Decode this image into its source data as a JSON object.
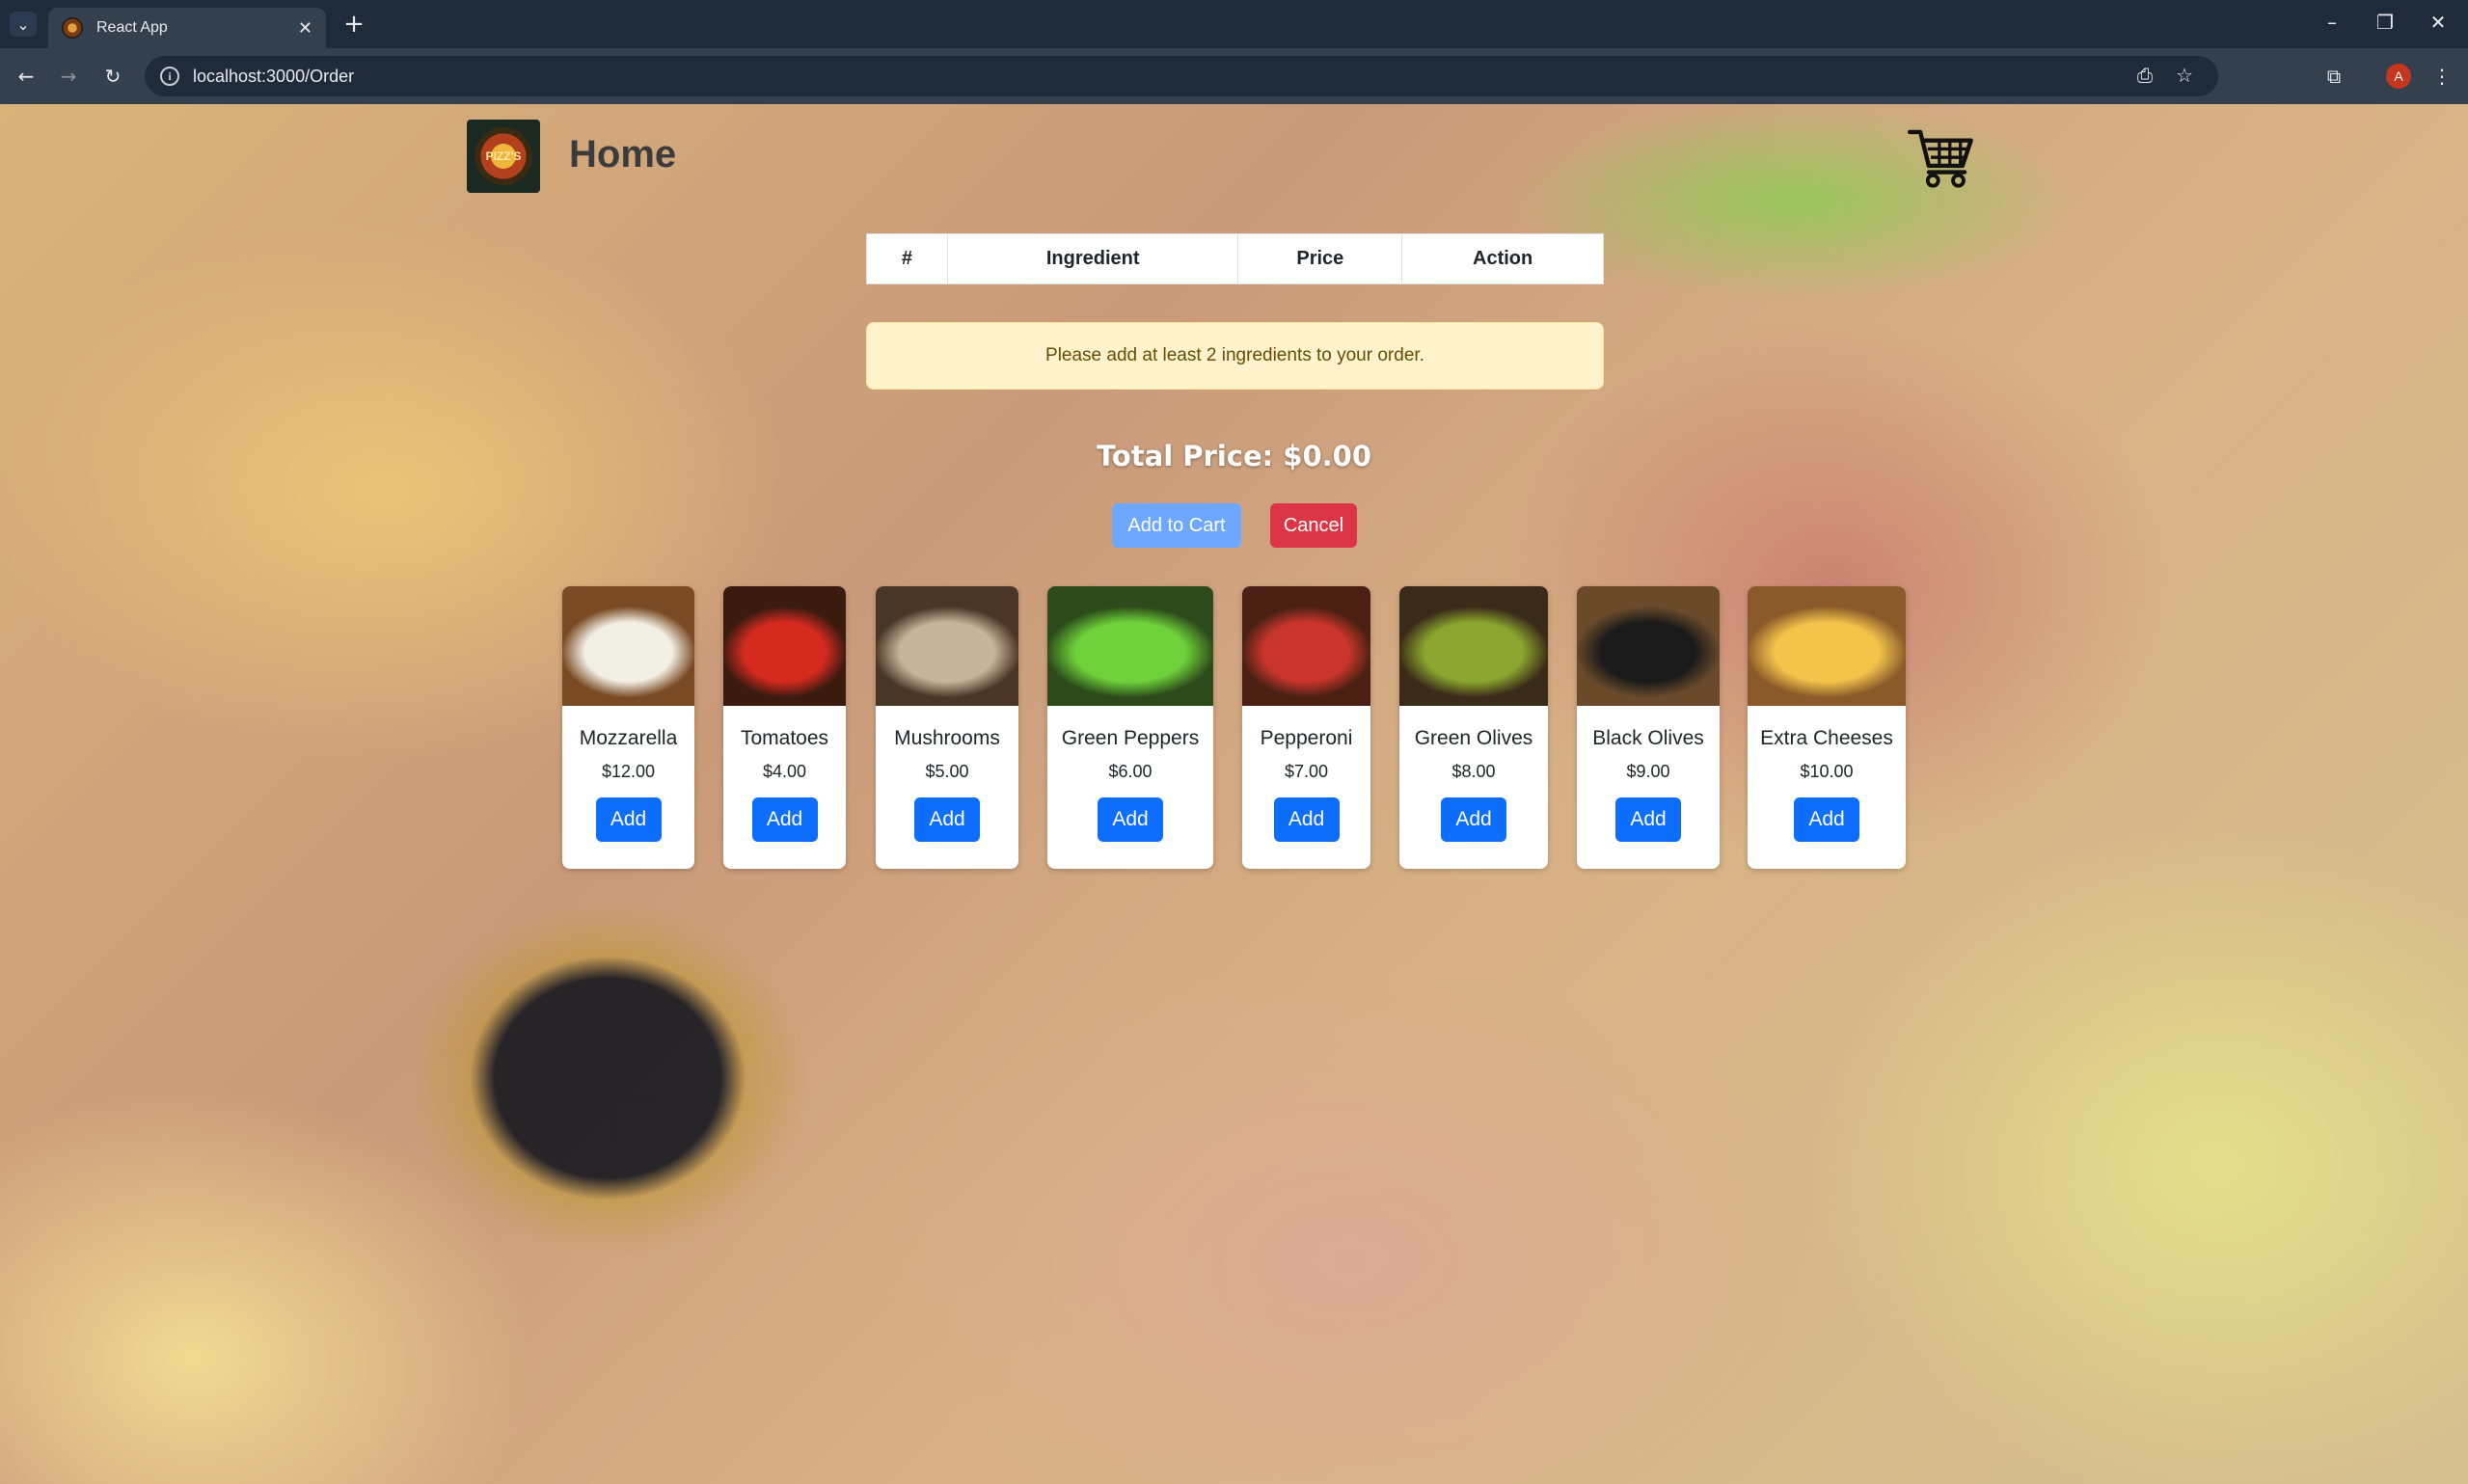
{
  "browser": {
    "tab_title": "React App",
    "url": "localhost:3000/Order",
    "profile_initial": "A"
  },
  "header": {
    "logo_text": "PIZZ'S",
    "home_label": "Home"
  },
  "table": {
    "headers": [
      "#",
      "Ingredient",
      "Price",
      "Action"
    ]
  },
  "alert": {
    "message": "Please add at least 2 ingredients to your order."
  },
  "total": {
    "label": "Total Price: $0.00"
  },
  "buttons": {
    "add_to_cart": "Add to Cart",
    "cancel": "Cancel"
  },
  "ingredients": [
    {
      "name": "Mozzarella",
      "price": "$12.00",
      "add": "Add",
      "color1": "#f2efe4",
      "color2": "#7a4a24"
    },
    {
      "name": "Tomatoes",
      "price": "$4.00",
      "add": "Add",
      "color1": "#d52b1e",
      "color2": "#3b1a10"
    },
    {
      "name": "Mushrooms",
      "price": "$5.00",
      "add": "Add",
      "color1": "#c8b49a",
      "color2": "#4a3626"
    },
    {
      "name": "Green Peppers",
      "price": "$6.00",
      "add": "Add",
      "color1": "#6fd23a",
      "color2": "#2c4a1a"
    },
    {
      "name": "Pepperoni",
      "price": "$7.00",
      "add": "Add",
      "color1": "#c9352a",
      "color2": "#4a2014"
    },
    {
      "name": "Green Olives",
      "price": "$8.00",
      "add": "Add",
      "color1": "#8aa62e",
      "color2": "#3a2a18"
    },
    {
      "name": "Black Olives",
      "price": "$9.00",
      "add": "Add",
      "color1": "#1a1a1a",
      "color2": "#6a4a2a"
    },
    {
      "name": "Extra Cheeses",
      "price": "$10.00",
      "add": "Add",
      "color1": "#f3c44a",
      "color2": "#8a5a2a"
    }
  ]
}
